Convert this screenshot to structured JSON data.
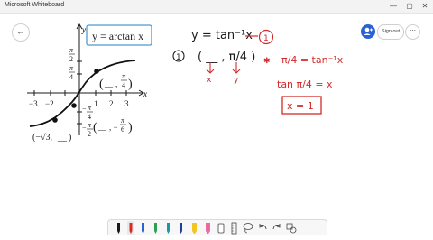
{
  "window": {
    "title": "Microsoft Whiteboard",
    "controls": {
      "minimize": "—",
      "maximize": "▢",
      "close": "✕"
    }
  },
  "header": {
    "back_icon": "←",
    "sign_out_label": "Sign out",
    "more_icon": "⋯",
    "share_icon": "person-add-icon"
  },
  "graph": {
    "label_box": "y = arctan x",
    "axis_x": "x",
    "axis_y": "y",
    "x_ticks": [
      "−3",
      "−2",
      "1",
      "2",
      "3"
    ],
    "y_tick_pi_2_top": "π",
    "y_tick_pi_2_bot": "2",
    "y_tick_pi_4_top": "π",
    "y_tick_pi_4_bot": "4",
    "y_tick_neg_pi_2_top": "π",
    "y_tick_neg_pi_2_bot": "2",
    "y_tick_neg_pi_4_top": "π",
    "y_tick_neg_pi_4_bot": "4",
    "minus": "−",
    "point_upper_open": "(",
    "point_upper_blank": "__",
    "point_upper_comma": ",",
    "point_upper_top": "π",
    "point_upper_bot": "4",
    "point_upper_close": ")",
    "point_lower_left": "(−√3,",
    "point_lower_left_blank": "__",
    "point_lower_left_close": ")",
    "point_lower_right_open": "(",
    "point_lower_right_blank": "__",
    "point_lower_right_comma": ", −",
    "point_lower_right_top": "π",
    "point_lower_right_bot": "6",
    "point_lower_right_close": ")"
  },
  "notes": {
    "equation": "y = tan⁻¹x",
    "circle_label": "1",
    "step_number": "1",
    "pair": "( __ , π/4 )",
    "arrow_label_x": "x",
    "arrow_label_y": "y",
    "work_line_1": "π/4 = tan⁻¹x",
    "work_line_2": "tan π/4 = x",
    "answer": "x = 1"
  },
  "toolbar": {
    "tools": [
      "black-pen-icon",
      "red-pen-icon",
      "blue-pen-icon",
      "green-pen-icon",
      "teal-pen-icon",
      "darkblue-pen-icon",
      "yellow-highlighter-icon",
      "pink-highlighter-icon",
      "eraser-icon",
      "ruler-icon",
      "lasso-icon",
      "undo-icon",
      "redo-icon",
      "shapes-icon"
    ]
  },
  "colors": {
    "ink_dark": "#1a1a1a",
    "ink_red": "#d42a2a",
    "ink_blue": "#1f3d99",
    "accent": "#2a62d6",
    "label_box": "#4a9ad4"
  }
}
